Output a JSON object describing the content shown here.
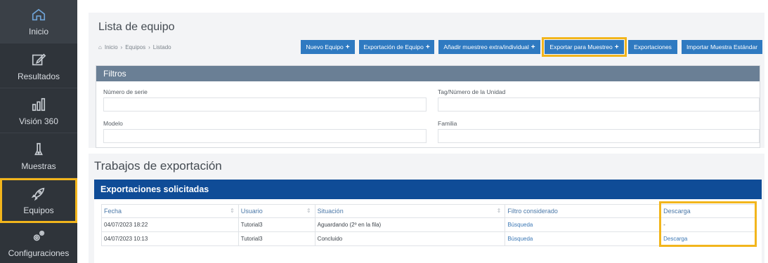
{
  "sidebar": {
    "items": [
      {
        "label": "Inicio",
        "icon": "home-icon"
      },
      {
        "label": "Resultados",
        "icon": "edit-icon"
      },
      {
        "label": "Visión 360",
        "icon": "bar-chart-icon"
      },
      {
        "label": "Muestras",
        "icon": "sample-icon"
      },
      {
        "label": "Equipos",
        "icon": "rocket-icon"
      },
      {
        "label": "Configuraciones",
        "icon": "gears-icon"
      }
    ]
  },
  "page": {
    "title": "Lista de equipo",
    "breadcrumb": [
      "Inicio",
      "Equipos",
      "Listado"
    ]
  },
  "actions": {
    "nuevo_equipo": "Nuevo Equipo",
    "exportacion_equipo": "Exportación de Equipo",
    "anadir_muestreo": "Añadir muestreo extra/individual",
    "exportar_muestreo": "Exportar para Muestreo",
    "exportaciones": "Exportaciones",
    "importar_muestra": "Importar Muestra Estándar"
  },
  "filters": {
    "title": "Filtros",
    "serial_label": "Número de serie",
    "tag_label": "Tag/Número de la Unidad",
    "model_label": "Modelo",
    "family_label": "Familia"
  },
  "exports": {
    "section_title": "Trabajos de exportación",
    "card_title": "Exportaciones solicitadas",
    "columns": [
      "Fecha",
      "Usuario",
      "Situación",
      "Filtro considerado",
      "Descarga"
    ],
    "rows": [
      [
        "04/07/2023 18:22",
        "Tutorial3",
        "Aguardando (2º en la fila)",
        "Búsqueda",
        "-"
      ],
      [
        "04/07/2023 10:13",
        "Tutorial3",
        "Concluido",
        "Búsqueda",
        "Descarga"
      ]
    ]
  },
  "colors": {
    "sidebar_bg": "#2f343a",
    "button_blue": "#2f7ac1",
    "header_navy": "#0f4c97",
    "highlight": "#f2b51c"
  }
}
